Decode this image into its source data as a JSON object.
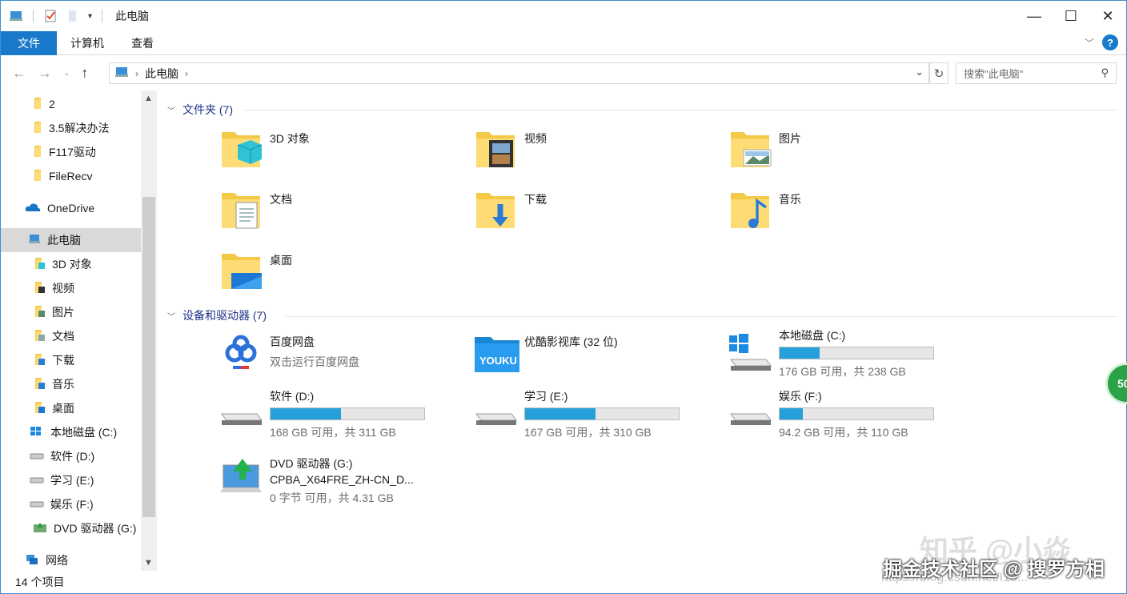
{
  "window": {
    "title": "此电脑"
  },
  "ribbon": {
    "tabs": [
      "文件",
      "计算机",
      "查看"
    ]
  },
  "address": {
    "crumb": "此电脑",
    "search_placeholder": "搜索\"此电脑\""
  },
  "nav_pane": {
    "items": [
      {
        "label": "2",
        "icon": "folder-icon"
      },
      {
        "label": "3.5解决办法",
        "icon": "folder-icon"
      },
      {
        "label": "F117驱动",
        "icon": "folder-icon"
      },
      {
        "label": "FileRecv",
        "icon": "folder-icon"
      },
      {
        "label": "OneDrive",
        "icon": "onedrive-icon"
      },
      {
        "label": "此电脑",
        "icon": "this-pc-icon"
      },
      {
        "label": "3D 对象",
        "icon": "3d-objects-icon"
      },
      {
        "label": "视频",
        "icon": "videos-icon"
      },
      {
        "label": "图片",
        "icon": "pictures-icon"
      },
      {
        "label": "文档",
        "icon": "documents-icon"
      },
      {
        "label": "下载",
        "icon": "downloads-icon"
      },
      {
        "label": "音乐",
        "icon": "music-icon"
      },
      {
        "label": "桌面",
        "icon": "desktop-icon"
      },
      {
        "label": "本地磁盘 (C:)",
        "icon": "windows-drive-icon"
      },
      {
        "label": "软件 (D:)",
        "icon": "drive-icon"
      },
      {
        "label": "学习 (E:)",
        "icon": "drive-icon"
      },
      {
        "label": "娱乐 (F:)",
        "icon": "drive-icon"
      },
      {
        "label": "DVD 驱动器 (G:)",
        "icon": "dvd-icon"
      },
      {
        "label": "网络",
        "icon": "network-icon"
      }
    ]
  },
  "folders_group": {
    "label": "文件夹 (7)"
  },
  "folders": [
    {
      "label": "3D 对象",
      "icon": "3d-objects-icon"
    },
    {
      "label": "视频",
      "icon": "videos-icon"
    },
    {
      "label": "图片",
      "icon": "pictures-icon"
    },
    {
      "label": "文档",
      "icon": "documents-icon"
    },
    {
      "label": "下载",
      "icon": "downloads-icon"
    },
    {
      "label": "音乐",
      "icon": "music-icon"
    },
    {
      "label": "桌面",
      "icon": "desktop-icon"
    }
  ],
  "devices_group": {
    "label": "设备和驱动器 (7)"
  },
  "devices": [
    {
      "label": "百度网盘",
      "sub": "双击运行百度网盘",
      "icon": "baidu-netdisk-icon"
    },
    {
      "label": "优酷影视库 (32 位)",
      "sub": "",
      "icon": "youku-icon",
      "logo_text": "YOUKU"
    },
    {
      "label": "本地磁盘 (C:)",
      "sub": "176 GB 可用，共 238 GB",
      "used_fraction": 0.26,
      "icon": "windows-drive-icon"
    },
    {
      "label": "软件 (D:)",
      "sub": "168 GB 可用，共 311 GB",
      "used_fraction": 0.46,
      "icon": "drive-icon"
    },
    {
      "label": "学习 (E:)",
      "sub": "167 GB 可用，共 310 GB",
      "used_fraction": 0.46,
      "icon": "drive-icon"
    },
    {
      "label": "娱乐 (F:)",
      "sub": "94.2 GB 可用，共 110 GB",
      "used_fraction": 0.15,
      "icon": "drive-icon"
    },
    {
      "label": "DVD 驱动器 (G:)",
      "label2": "CPBA_X64FRE_ZH-CN_D...",
      "sub": "0 字节 可用，共 4.31 GB",
      "icon": "dvd-icon"
    }
  ],
  "status": {
    "count": "14 个项目"
  },
  "overlay": {
    "badge": "50",
    "watermark1": "知乎 @小焱",
    "watermark2": "掘金技术社区 @ 搜罗方相",
    "watermark3": "https://blog.csdn.net/I1o..."
  },
  "colors": {
    "accent": "#1979ca",
    "bar_fill": "#26a0da",
    "group_text": "#1e3287"
  }
}
